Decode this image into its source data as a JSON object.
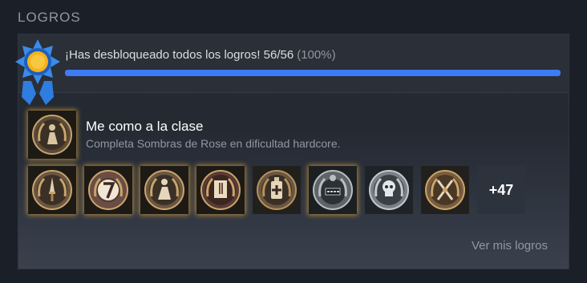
{
  "section": {
    "title": "LOGROS"
  },
  "summary": {
    "text": "¡Has desbloqueado todos los logros! 56/56",
    "percent_text": "(100%)",
    "progress": 1.0,
    "unlocked": 56,
    "total": 56,
    "badge_icon": "sun-ribbon-badge-icon"
  },
  "featured": {
    "title": "Me como a la clase",
    "description": "Completa Sombras de Rose en dificultad hardcore.",
    "icon": "laurel-figure-icon"
  },
  "achievements": [
    {
      "icon": "dagger-laurel-icon",
      "style": "gold"
    },
    {
      "icon": "number-seven-laurel-icon",
      "style": "gold"
    },
    {
      "icon": "figure-laurel-icon",
      "style": "gold"
    },
    {
      "icon": "scroll-laurel-icon",
      "style": "gold"
    },
    {
      "icon": "medicine-bottle-laurel-icon",
      "style": "plain"
    },
    {
      "icon": "clock-laurel-icon",
      "style": "gold"
    },
    {
      "icon": "skull-laurel-icon",
      "style": "plain"
    },
    {
      "icon": "crossed-weapons-laurel-icon",
      "style": "plain"
    }
  ],
  "more_count": "+47",
  "link": {
    "label": "Ver mis logros"
  },
  "colors": {
    "background": "#1b1f27",
    "progress_fill": "#3e7cf5",
    "badge_blue": "#2e7de0",
    "badge_sun": "#f5b21c",
    "gold_glow": "#e2a83c"
  }
}
